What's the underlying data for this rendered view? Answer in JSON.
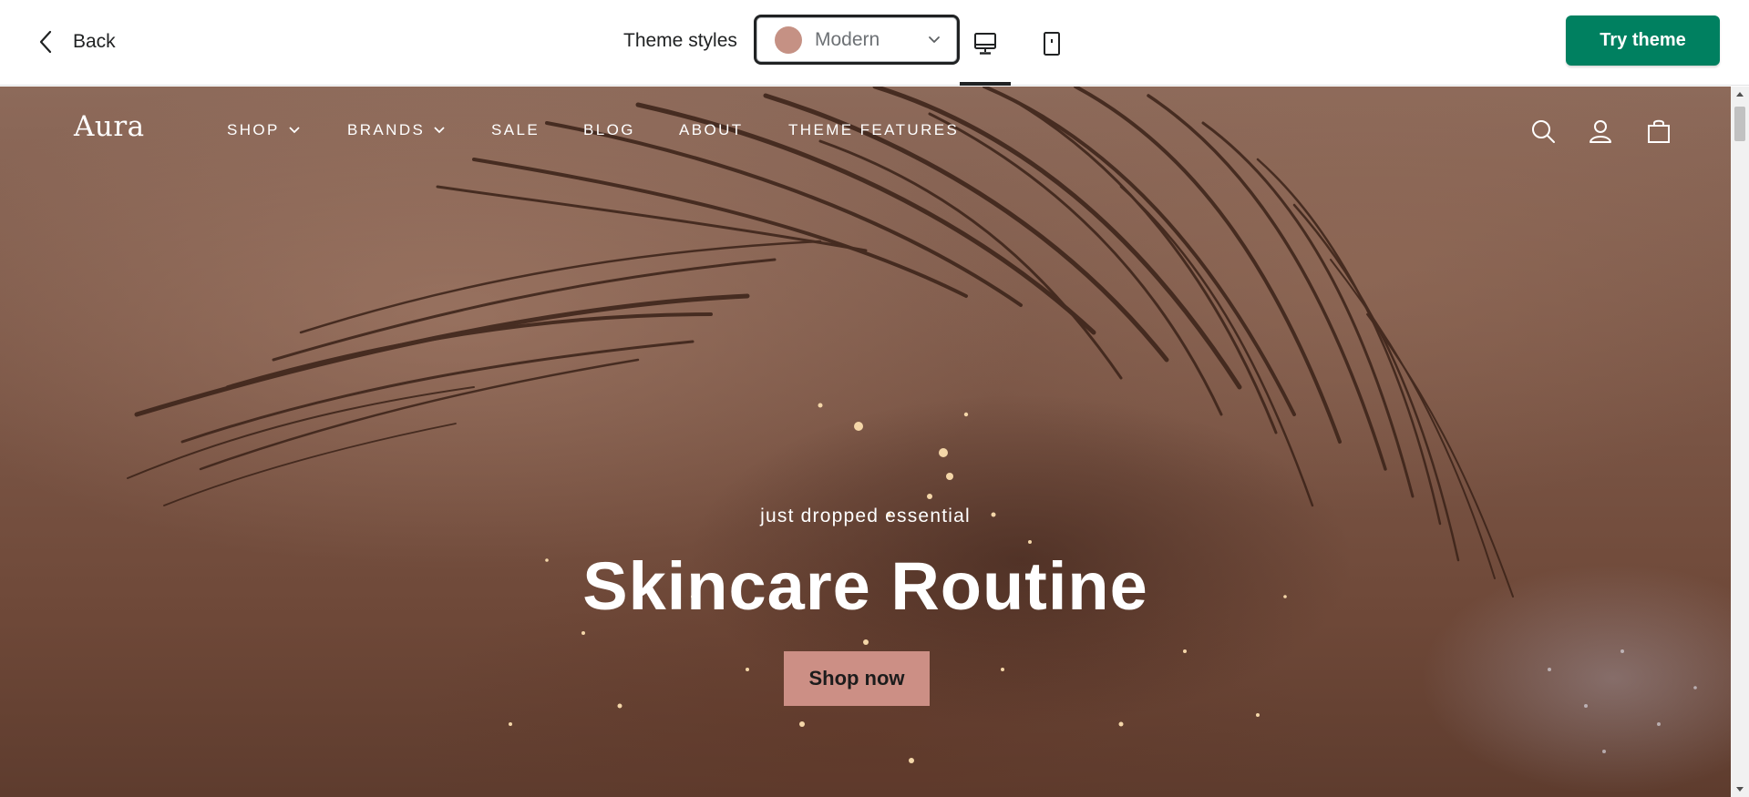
{
  "topbar": {
    "back_label": "Back",
    "theme_styles_label": "Theme styles",
    "style_select": {
      "selected": "Modern",
      "swatch_color": "#c59184"
    },
    "devices": {
      "desktop_icon": "desktop-icon",
      "mobile_icon": "mobile-icon",
      "active": "desktop"
    },
    "try_theme_label": "Try theme",
    "accent_color": "#008060"
  },
  "store": {
    "logo": "Aura",
    "nav": [
      {
        "label": "SHOP",
        "has_dropdown": true
      },
      {
        "label": "BRANDS",
        "has_dropdown": true
      },
      {
        "label": "SALE",
        "has_dropdown": false
      },
      {
        "label": "BLOG",
        "has_dropdown": false
      },
      {
        "label": "ABOUT",
        "has_dropdown": false
      },
      {
        "label": "THEME FEATURES",
        "has_dropdown": false
      }
    ],
    "header_icons": [
      "search-icon",
      "account-icon",
      "cart-icon"
    ],
    "hero": {
      "eyebrow": "just dropped essential",
      "headline": "Skincare Routine",
      "cta_label": "Shop now",
      "cta_color": "#cc8f85"
    }
  }
}
